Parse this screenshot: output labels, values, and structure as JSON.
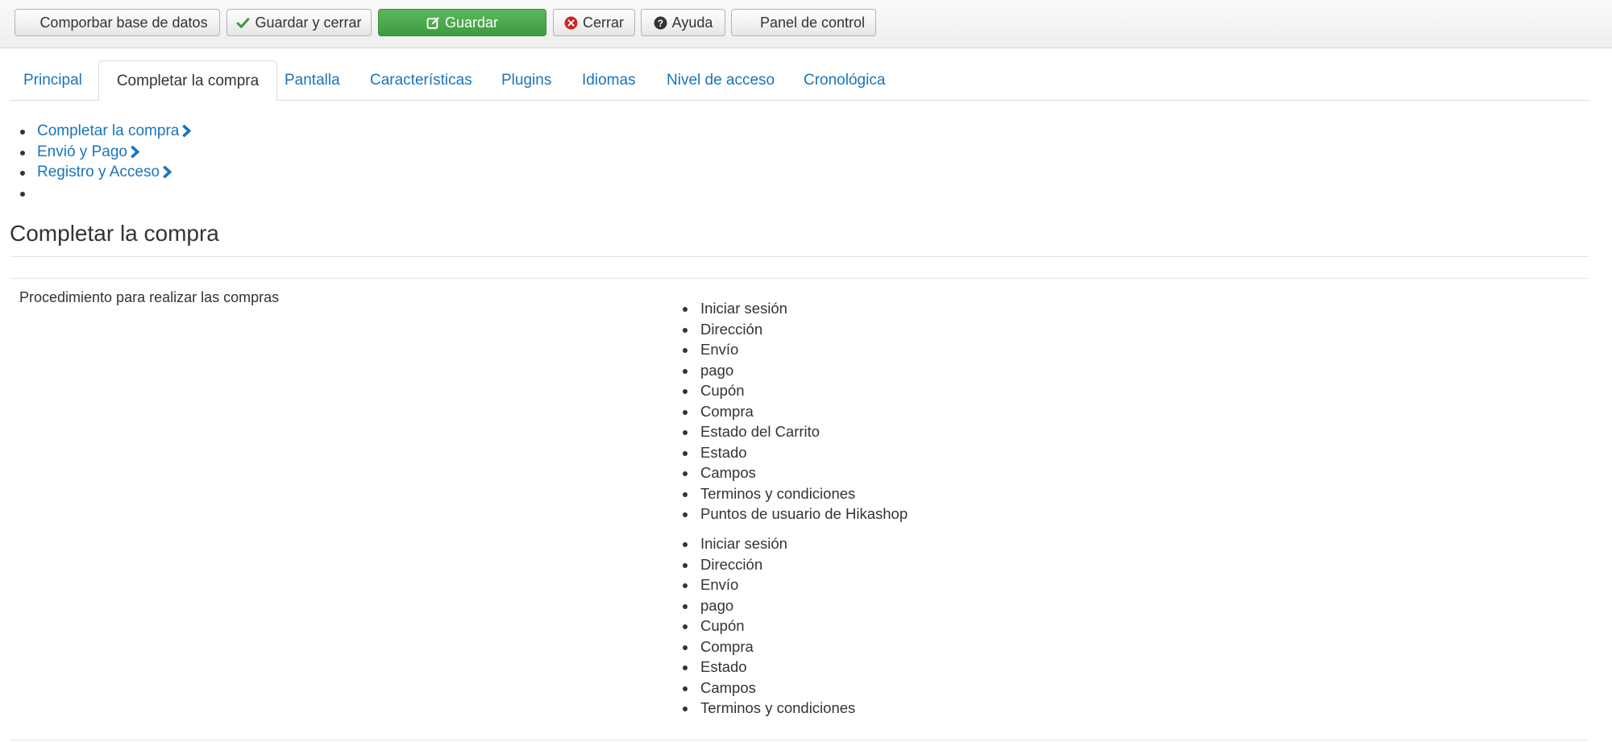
{
  "toolbar": {
    "check_db_label": "Comporbar base de datos",
    "save_close_label": "Guardar y cerrar",
    "save_label": "Guardar",
    "close_label": "Cerrar",
    "help_label": "Ayuda",
    "control_panel_label": "Panel de control"
  },
  "tabs": [
    {
      "label": "Principal"
    },
    {
      "label": "Completar la compra"
    },
    {
      "label": "Pantalla"
    },
    {
      "label": "Características"
    },
    {
      "label": "Plugins"
    },
    {
      "label": "Idiomas"
    },
    {
      "label": "Nivel de acceso"
    },
    {
      "label": "Cronológica"
    }
  ],
  "subnav": [
    {
      "label": "Completar la compra"
    },
    {
      "label": "Envió y Pago"
    },
    {
      "label": "Registro y Acceso"
    }
  ],
  "section_title": "Completar la compra",
  "procedure_label": "Procedimiento para realizar las compras",
  "steps_list_1": [
    "Iniciar sesión",
    "Dirección",
    "Envío",
    "pago",
    "Cupón",
    "Compra",
    "Estado del Carrito",
    "Estado",
    "Campos",
    "Terminos y condiciones",
    "Puntos de usuario de Hikashop"
  ],
  "steps_list_2": [
    "Iniciar sesión",
    "Dirección",
    "Envío",
    "pago",
    "Cupón",
    "Compra",
    "Estado",
    "Campos",
    "Terminos y condiciones"
  ],
  "colors": {
    "link": "#1a75bb",
    "save_green": "#4cae4c",
    "close_red": "#cc2222"
  }
}
